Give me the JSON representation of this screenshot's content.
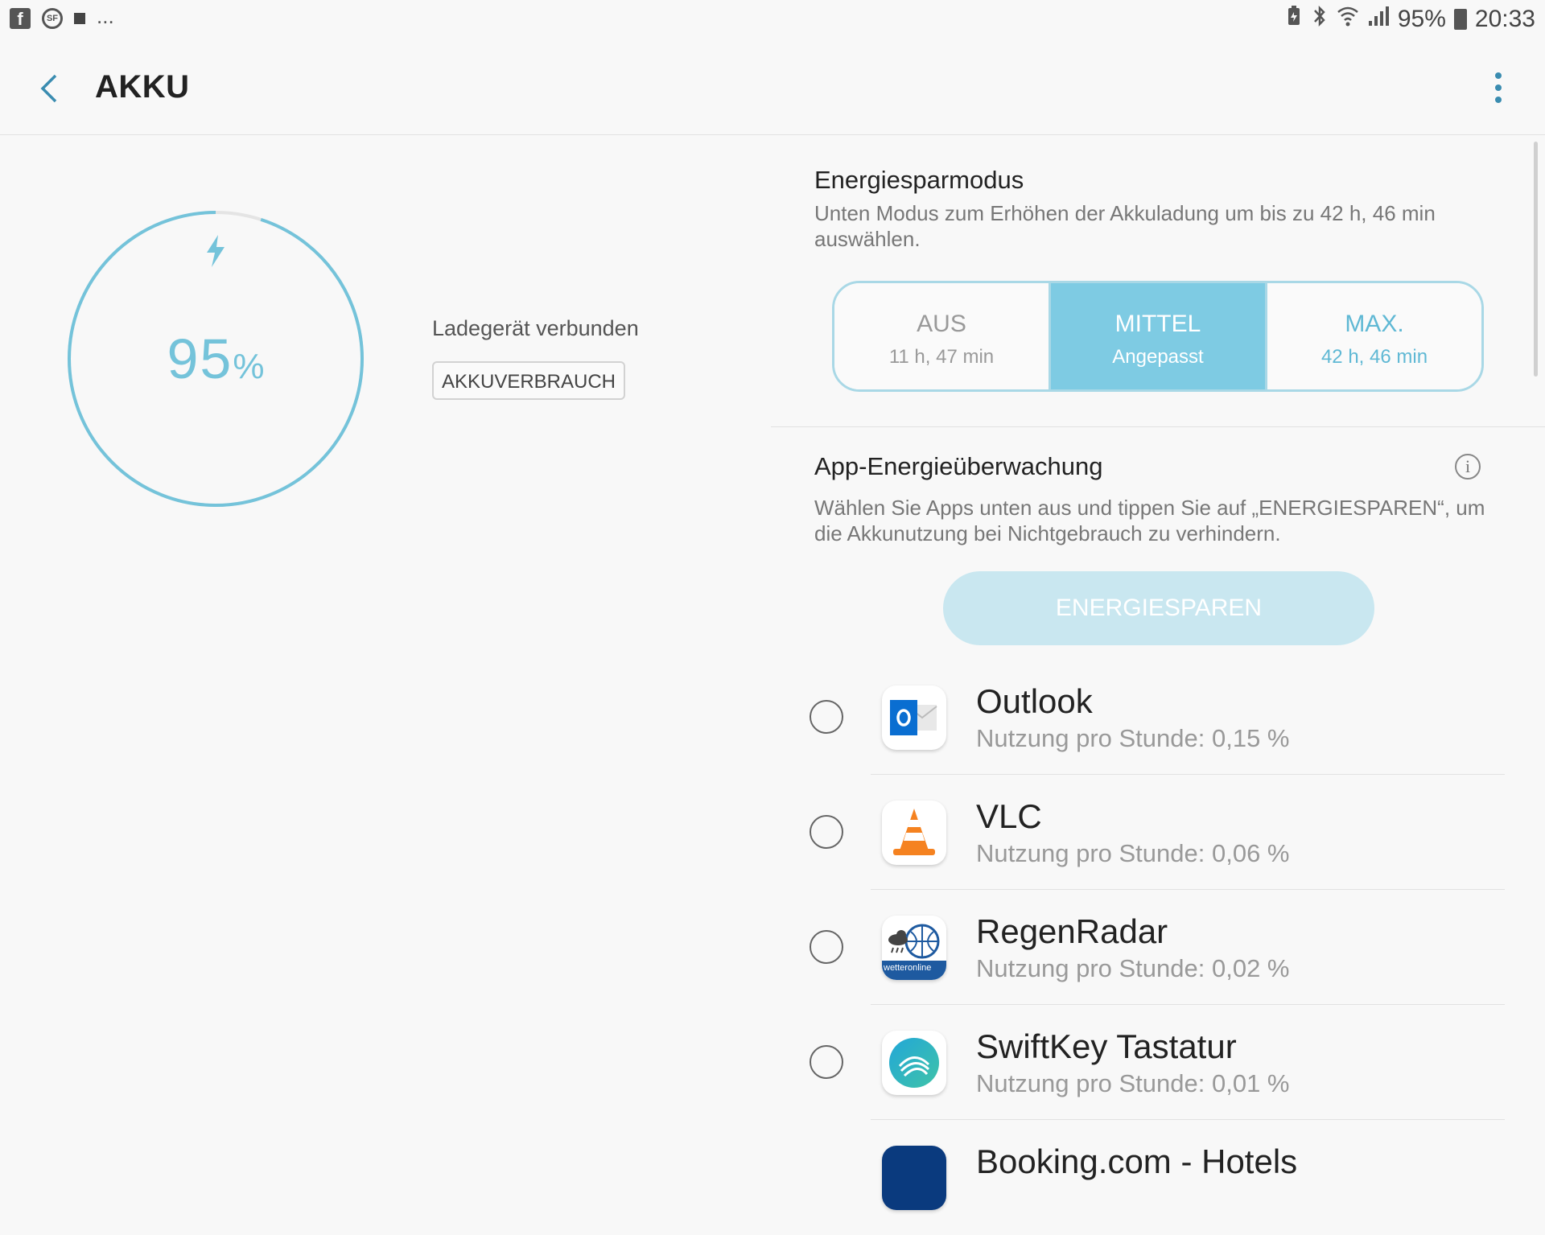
{
  "status_bar": {
    "dots": "...",
    "battery": "95%",
    "time": "20:33"
  },
  "header": {
    "title": "AKKU"
  },
  "battery_panel": {
    "percent": "95",
    "unit": "%",
    "level": 0.95,
    "charger_status": "Ladegerät verbunden",
    "usage_button": "AKKUVERBRAUCH"
  },
  "power_saving": {
    "title": "Energiesparmodus",
    "description": "Unten Modus zum Erhöhen der Akkuladung um bis zu 42 h, 46 min auswählen.",
    "modes": [
      {
        "label": "AUS",
        "sub": "11 h, 47 min"
      },
      {
        "label": "MITTEL",
        "sub": "Angepasst"
      },
      {
        "label": "MAX.",
        "sub": "42 h, 46 min"
      }
    ]
  },
  "app_monitor": {
    "title": "App-Energieüberwachung",
    "description": "Wählen Sie Apps unten aus und tippen Sie auf „ENERGIESPAREN“, um die Akkunutzung bei Nichtgebrauch zu verhindern.",
    "save_button": "ENERGIESPAREN",
    "apps": [
      {
        "name": "Outlook",
        "usage": "Nutzung pro Stunde: 0,15 %"
      },
      {
        "name": "VLC",
        "usage": "Nutzung pro Stunde: 0,06 %"
      },
      {
        "name": "RegenRadar",
        "usage": "Nutzung pro Stunde: 0,02 %",
        "icon_text": "wetteronline"
      },
      {
        "name": "SwiftKey Tastatur",
        "usage": "Nutzung pro Stunde: 0,01 %"
      },
      {
        "name": "Booking.com - Hotels",
        "usage": ""
      }
    ]
  },
  "colors": {
    "accent": "#74c3da",
    "mode_active": "#7ecbe3",
    "mode_border": "#a9d8e6",
    "save_button_disabled": "#c9e7f0",
    "back_icon": "#3a8cb0"
  }
}
